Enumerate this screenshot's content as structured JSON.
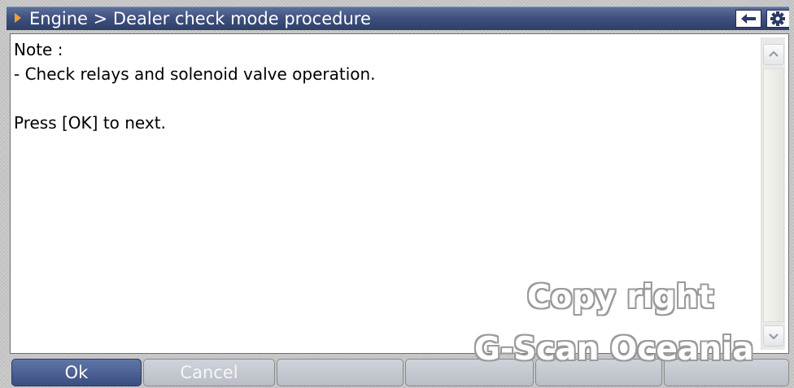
{
  "window": {
    "title": "Engine > Dealer check mode procedure",
    "accent_color": "#3f5180",
    "arrow_color": "#f0a030"
  },
  "toolbar": {
    "back_icon": "arrow-left-icon",
    "settings_icon": "gear-icon"
  },
  "content": {
    "lines": [
      "Note :",
      "- Check relays and solenoid valve operation.",
      "",
      "Press [OK] to next."
    ]
  },
  "watermark": {
    "line1": "Copy right",
    "line2": "G-Scan Oceania"
  },
  "buttons": {
    "ok_label": "Ok",
    "cancel_label": "Cancel"
  }
}
